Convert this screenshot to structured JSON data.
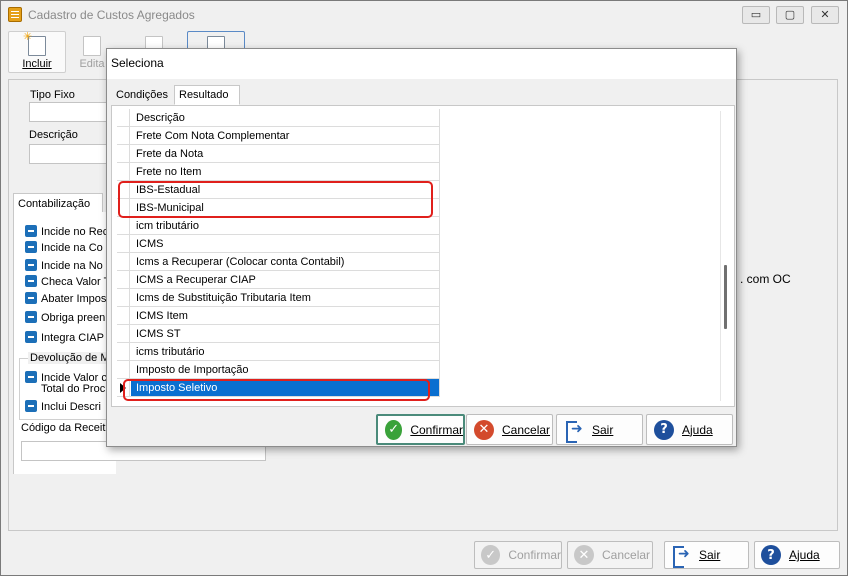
{
  "main": {
    "title": "Cadastro de Custos Agregados",
    "window_controls": {
      "minimize": "▭",
      "maximize": "▢",
      "close": "✕"
    },
    "toolbar": {
      "incluir": "Incluir",
      "editar": "Edita"
    },
    "tipo_fixo_label": "Tipo Fixo",
    "descricao_label": "Descrição",
    "tab_contabilizacao": "Contabilização",
    "checkboxes": [
      "Incide no Rec",
      "Incide na Co",
      "Incide na No",
      "Checa Valor T",
      "Abater Impos",
      "Obriga preen",
      "Integra CIAP"
    ],
    "devolucao_group": "Devolução de M",
    "dev_checkboxes": [
      "Incide Valor c",
      "Total do Proc",
      "Inclui Descri"
    ],
    "codigo_receita_label": "Código da Receit",
    "right_text": ". com OC",
    "buttons": {
      "confirmar": "Confirmar",
      "cancelar": "Cancelar",
      "sair": "Sair",
      "ajuda": "Ajuda"
    }
  },
  "dialog": {
    "title": "Seleciona",
    "tabs": [
      "Condições",
      "Resultado"
    ],
    "rows": [
      "Descrição",
      "Frete Com Nota Complementar",
      "Frete da Nota",
      "Frete no Item",
      "IBS-Estadual",
      "IBS-Municipal",
      "icm tributário",
      "ICMS",
      "Icms a Recuperar (Colocar conta Contabil)",
      "ICMS a Recuperar CIAP",
      "Icms de Substituição Tributaria Item",
      "ICMS Item",
      "ICMS ST",
      "icms tributário",
      "Imposto de Importação",
      "Imposto Seletivo"
    ],
    "selected_row": "Imposto Seletivo",
    "buttons": {
      "confirmar": "Confirmar",
      "cancelar": "Cancelar",
      "sair": "Sair",
      "ajuda": "Ajuda"
    }
  },
  "colors": {
    "selection": "#0a6fd0",
    "highlight": "#e0201c",
    "checkbox": "#1c6fb8"
  }
}
